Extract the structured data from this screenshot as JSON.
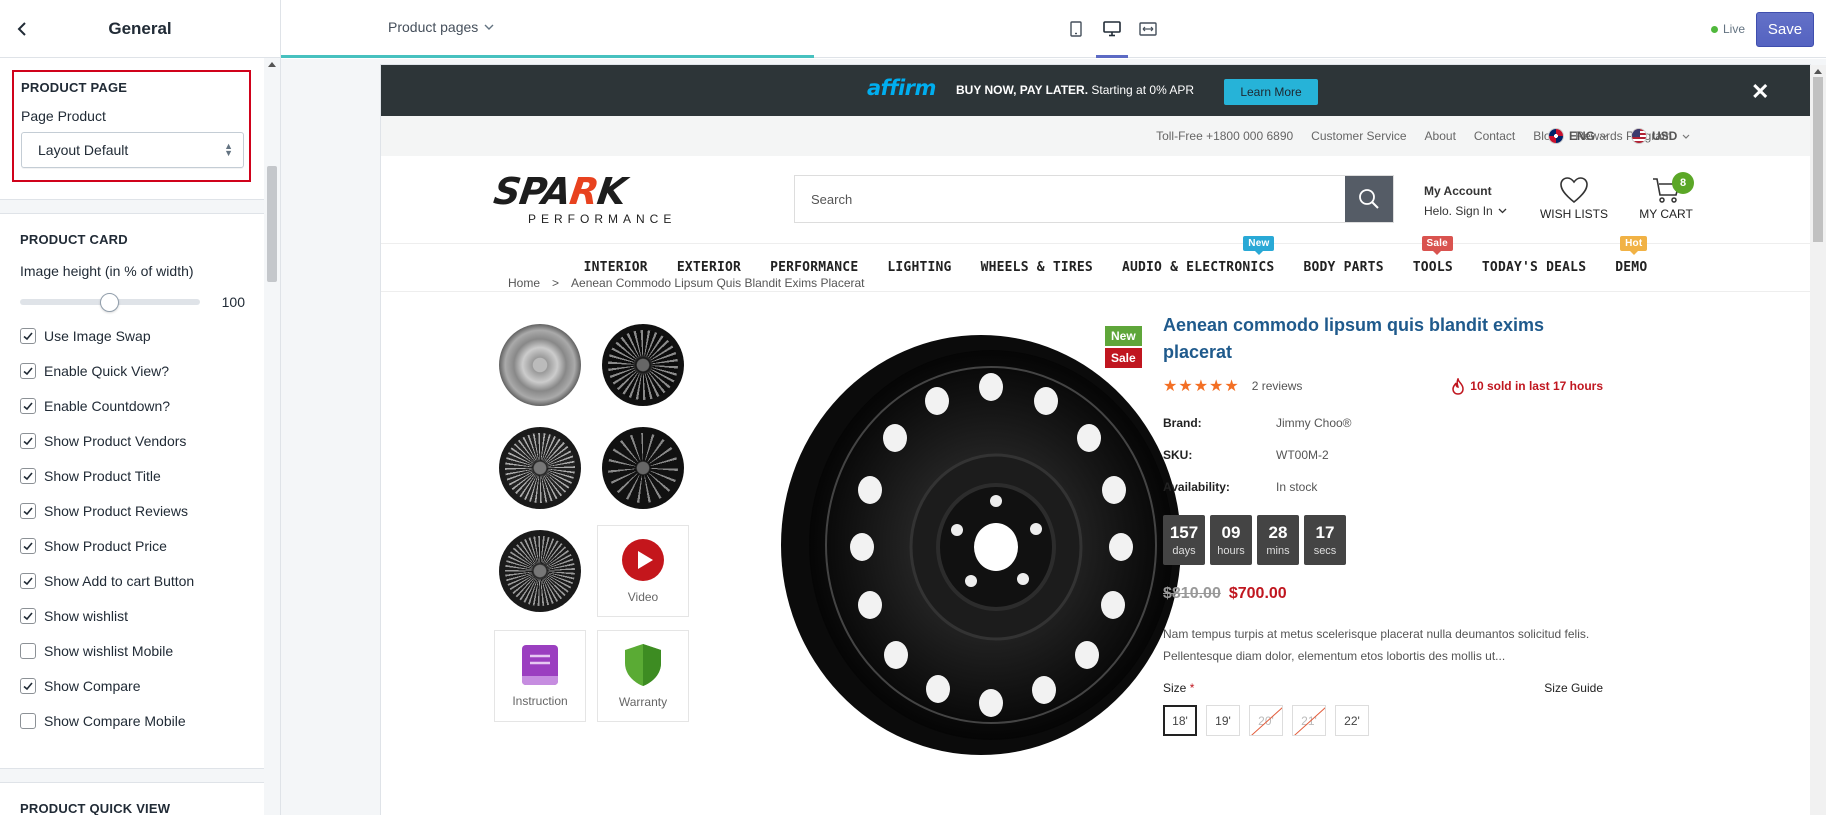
{
  "sidebar": {
    "title": "General",
    "product_page": {
      "heading": "PRODUCT PAGE",
      "field_label": "Page Product",
      "select_value": "Layout Default"
    },
    "product_card": {
      "heading": "PRODUCT CARD",
      "slider_label": "Image height (in % of width)",
      "slider_value": "100",
      "options": [
        {
          "label": "Use Image Swap",
          "checked": true
        },
        {
          "label": "Enable Quick View?",
          "checked": true
        },
        {
          "label": "Enable Countdown?",
          "checked": true
        },
        {
          "label": "Show Product Vendors",
          "checked": true
        },
        {
          "label": "Show Product Title",
          "checked": true
        },
        {
          "label": "Show Product Reviews",
          "checked": true
        },
        {
          "label": "Show Product Price",
          "checked": true
        },
        {
          "label": "Show Add to cart Button",
          "checked": true
        },
        {
          "label": "Show wishlist",
          "checked": true
        },
        {
          "label": "Show wishlist Mobile",
          "checked": false
        },
        {
          "label": "Show Compare",
          "checked": true
        },
        {
          "label": "Show Compare Mobile",
          "checked": false
        }
      ]
    },
    "quick_view": {
      "heading": "PRODUCT QUICK VIEW"
    }
  },
  "toolbar": {
    "pages_dropdown": "Product pages",
    "status": "Live",
    "save_label": "Save",
    "accent": "#5c6ac4"
  },
  "store": {
    "promo": {
      "brand": "affirm",
      "bold_text": "BUY NOW, PAY LATER.",
      "text": " Starting at 0% APR",
      "button": "Learn More",
      "close": "✕"
    },
    "utility_links": [
      "Toll-Free +1800 000 6890",
      "Customer Service",
      "About",
      "Contact",
      "Blog",
      "Rewards Program"
    ],
    "language": "ENG",
    "currency": "USD",
    "logo": {
      "main_a": "SPA",
      "main_b": "R",
      "main_c": "K",
      "sub": "PERFORMANCE"
    },
    "search_placeholder": "Search",
    "account": {
      "title": "My Account",
      "sub": "Helo. Sign In"
    },
    "wishlist_label": "WISH LISTS",
    "cart_label": "MY CART",
    "cart_count": "8",
    "nav": [
      {
        "label": "INTERIOR",
        "tag": ""
      },
      {
        "label": "EXTERIOR",
        "tag": ""
      },
      {
        "label": "PERFORMANCE",
        "tag": ""
      },
      {
        "label": "LIGHTING",
        "tag": ""
      },
      {
        "label": "WHEELS & TIRES",
        "tag": ""
      },
      {
        "label": "AUDIO & ELECTRONICS",
        "tag": "New"
      },
      {
        "label": "BODY PARTS",
        "tag": ""
      },
      {
        "label": "TOOLS",
        "tag": "Sale"
      },
      {
        "label": "TODAY'S DEALS",
        "tag": ""
      },
      {
        "label": "DEMO",
        "tag": "Hot"
      }
    ],
    "breadcrumb": {
      "home": "Home",
      "sep": ">",
      "current": "Aenean Commodo Lipsum Quis Blandit Exims Placerat"
    },
    "media": {
      "video_label": "Video",
      "instruction_label": "Instruction",
      "warranty_label": "Warranty"
    },
    "badges": {
      "new": "New",
      "sale": "Sale"
    },
    "product": {
      "title": "Aenean commodo lipsum quis blandit exims placerat",
      "stars": "★★★★★",
      "reviews": "2 reviews",
      "sold": "10 sold in last 17 hours",
      "brand_label": "Brand:",
      "brand": "Jimmy Choo®",
      "sku_label": "SKU:",
      "sku": "WT00M-2",
      "availability_label": "Availability:",
      "availability": "In stock",
      "countdown": [
        {
          "n": "157",
          "l": "days"
        },
        {
          "n": "09",
          "l": "hours"
        },
        {
          "n": "28",
          "l": "mins"
        },
        {
          "n": "17",
          "l": "secs"
        }
      ],
      "old_price": "$810.00",
      "price": "$700.00",
      "description": "Nam tempus turpis at metus scelerisque placerat nulla deumantos solicitud felis. Pellentesque diam dolor, elementum etos lobortis des mollis ut...",
      "size_label": "Size",
      "size_required": "*",
      "size_guide": "Size Guide",
      "sizes": [
        {
          "v": "18'",
          "state": "selected"
        },
        {
          "v": "19'",
          "state": "available"
        },
        {
          "v": "20'",
          "state": "disabled"
        },
        {
          "v": "21'",
          "state": "disabled"
        },
        {
          "v": "22'",
          "state": "available"
        }
      ]
    }
  }
}
